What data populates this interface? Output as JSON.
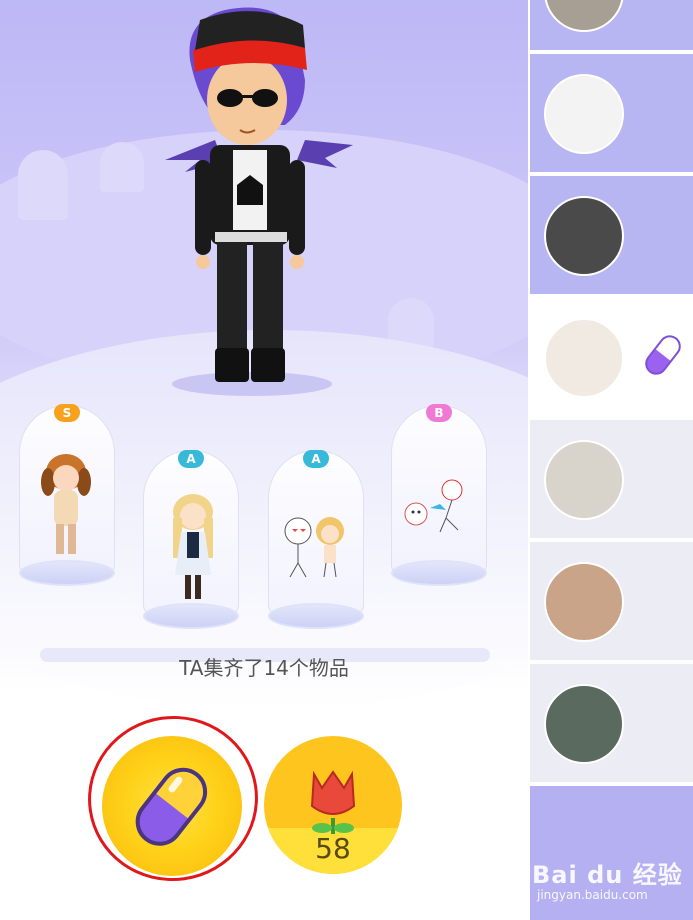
{
  "collection": {
    "count_text": "TA集齐了14个物品",
    "items": [
      {
        "rank": "S",
        "rank_color": "#f6a21d",
        "name": "dog-costume-doll"
      },
      {
        "rank": "A",
        "rank_color": "#39b9d9",
        "name": "elf-girl-doll"
      },
      {
        "rank": "A",
        "rank_color": "#39b9d9",
        "name": "couple-doll"
      },
      {
        "rank": "B",
        "rank_color": "#ee7ad6",
        "name": "cartoon-duo-doll"
      }
    ]
  },
  "actions": {
    "capsule_icon": "capsule-icon",
    "flower_icon": "tulip-icon",
    "flower_count": "58"
  },
  "sidebar": {
    "users": [
      {
        "avatar": "user-avatar-1"
      },
      {
        "avatar": "user-avatar-2"
      },
      {
        "avatar": "user-avatar-3"
      },
      {
        "avatar": "user-avatar-4",
        "active": true
      },
      {
        "avatar": "user-avatar-5"
      },
      {
        "avatar": "user-avatar-6"
      },
      {
        "avatar": "user-avatar-7"
      }
    ]
  },
  "watermark": {
    "brand": "Bai du 经验",
    "url": "jingyan.baidu.com"
  },
  "colors": {
    "stage_purple": "#bdb8f6",
    "button_yellow": "#ffd21a",
    "capsule_purple": "#8a5ce8",
    "annotation_red": "#e0181b"
  }
}
